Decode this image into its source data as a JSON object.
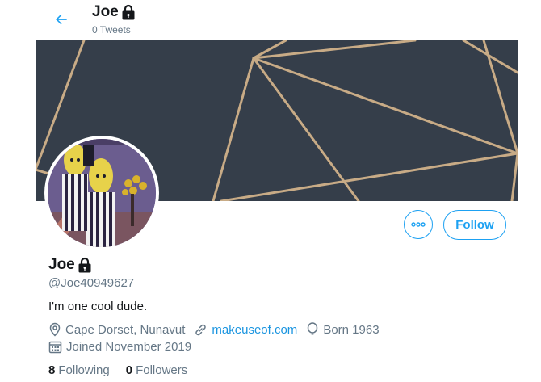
{
  "header": {
    "title": "Joe",
    "tweet_count": "0 Tweets",
    "back_icon": "arrow-left-icon",
    "accent": "#1da1f2"
  },
  "profile": {
    "name": "Joe",
    "handle": "@Joe40949627",
    "bio": "I'm one cool dude.",
    "location": "Cape Dorset, Nunavut",
    "website": "makeuseof.com",
    "born": "Born 1963",
    "joined": "Joined November 2019",
    "following_count": "8",
    "following_label": "Following",
    "followers_count": "0",
    "followers_label": "Followers",
    "protected_icon": "lock-icon"
  },
  "actions": {
    "more_icon": "more-icon",
    "follow_label": "Follow"
  },
  "colors": {
    "accent": "#1da1f2",
    "link": "#1b95e0",
    "secondary_text": "#657786",
    "banner": "#353e4a",
    "banner_lines": "#c8ab86"
  }
}
